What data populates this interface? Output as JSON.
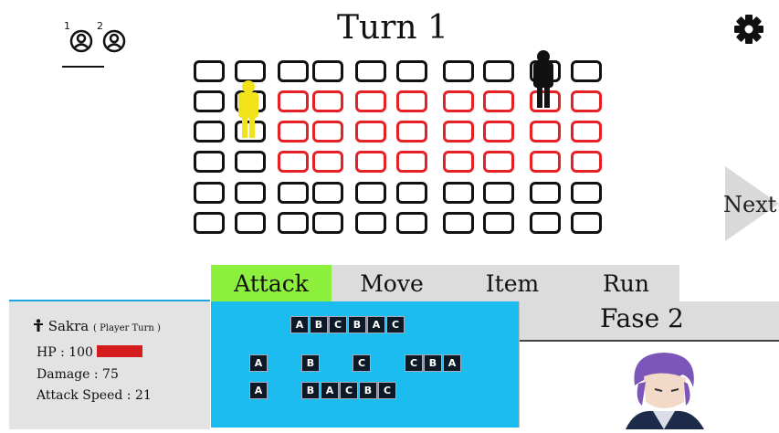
{
  "header": {
    "turn_label": "Turn 1",
    "players": [
      {
        "number": "1",
        "icon": "user-circle-icon"
      },
      {
        "number": "2",
        "icon": "user-circle-icon"
      }
    ],
    "settings_icon": "gear-icon"
  },
  "board": {
    "rows": 6,
    "columns": 10,
    "highlight_color": "#e52125",
    "highlighted_cells": [
      [
        1,
        2
      ],
      [
        1,
        3
      ],
      [
        1,
        4
      ],
      [
        1,
        5
      ],
      [
        1,
        6
      ],
      [
        1,
        7
      ],
      [
        1,
        8
      ],
      [
        1,
        9
      ],
      [
        2,
        2
      ],
      [
        2,
        3
      ],
      [
        2,
        4
      ],
      [
        2,
        5
      ],
      [
        2,
        6
      ],
      [
        2,
        7
      ],
      [
        2,
        8
      ],
      [
        2,
        9
      ],
      [
        3,
        2
      ],
      [
        3,
        3
      ],
      [
        3,
        4
      ],
      [
        3,
        5
      ],
      [
        3,
        6
      ],
      [
        3,
        7
      ],
      [
        3,
        8
      ],
      [
        3,
        9
      ]
    ],
    "units": [
      {
        "name": "player-unit",
        "row": 1,
        "col": 1,
        "color": "#f2e21a"
      },
      {
        "name": "enemy-unit",
        "row": 0,
        "col": 8,
        "color": "#111111"
      }
    ]
  },
  "next_button": {
    "label": "Next"
  },
  "tabs": [
    {
      "id": "attack",
      "label": "Attack",
      "active": true
    },
    {
      "id": "move",
      "label": "Move",
      "active": false
    },
    {
      "id": "item",
      "label": "Item",
      "active": false
    },
    {
      "id": "run",
      "label": "Run",
      "active": false
    }
  ],
  "character": {
    "name": "Sakra",
    "turn_note": "( Player Turn )",
    "hp": "HP : 100",
    "hp_fraction": 1.0,
    "damage": "Damage : 75",
    "attack_speed": "Attack Speed : 21"
  },
  "skills": {
    "combo_1": [
      "A",
      "B",
      "C",
      "B",
      "A",
      "C"
    ],
    "combo_2_a": [
      "A"
    ],
    "combo_2_b": [
      "B"
    ],
    "combo_2_c": [
      "C"
    ],
    "combo_2_d": [
      "C",
      "B",
      "A"
    ],
    "combo_3_a": [
      "A"
    ],
    "combo_3_b": [
      "B",
      "A",
      "C",
      "B",
      "C"
    ]
  },
  "phase": {
    "label": "Fase 2"
  },
  "colors": {
    "attack_tab": "#8df03c",
    "tab_bg": "#dcdcdc",
    "skill_panel": "#1bbdf0",
    "stats_panel": "#e3e3e3"
  }
}
